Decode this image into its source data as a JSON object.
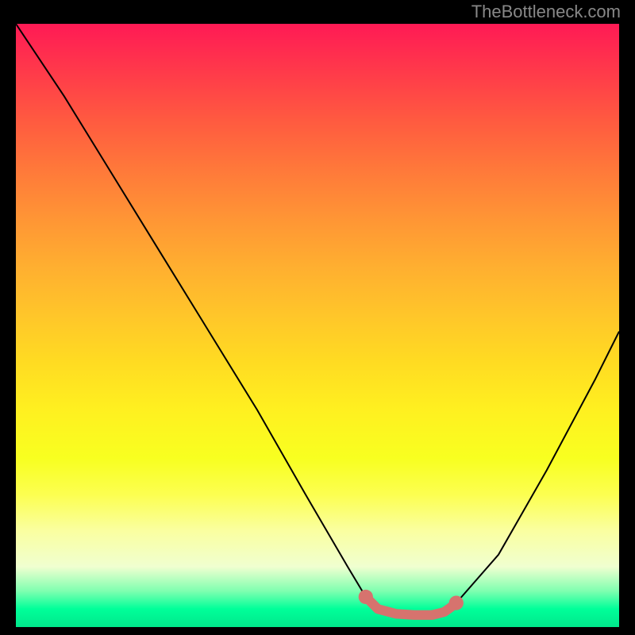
{
  "watermark": "TheBottleneck.com",
  "chart_data": {
    "type": "line",
    "title": "",
    "xlabel": "",
    "ylabel": "",
    "xlim": [
      0,
      100
    ],
    "ylim": [
      0,
      100
    ],
    "background_gradient": {
      "top": "#ff1a55",
      "middle": "#ffdb22",
      "bottom": "#00e88c"
    },
    "series": [
      {
        "name": "main-curve",
        "color": "#000000",
        "x": [
          0,
          8,
          16,
          24,
          32,
          40,
          48,
          55,
          58,
          60,
          65,
          70,
          73,
          80,
          88,
          96,
          100
        ],
        "y": [
          100,
          88,
          75,
          62,
          49,
          36,
          22,
          10,
          5,
          3,
          2,
          2,
          4,
          12,
          26,
          41,
          49
        ]
      },
      {
        "name": "highlight-segment",
        "color": "#d6736e",
        "style": "thick-dotted",
        "x": [
          58,
          60,
          63,
          66,
          69,
          71,
          72,
          73
        ],
        "y": [
          5,
          3,
          2.2,
          2.0,
          2.0,
          2.5,
          3.2,
          4.0
        ]
      }
    ],
    "highlight_points": [
      {
        "x": 58,
        "y": 5
      },
      {
        "x": 73,
        "y": 4
      }
    ]
  }
}
